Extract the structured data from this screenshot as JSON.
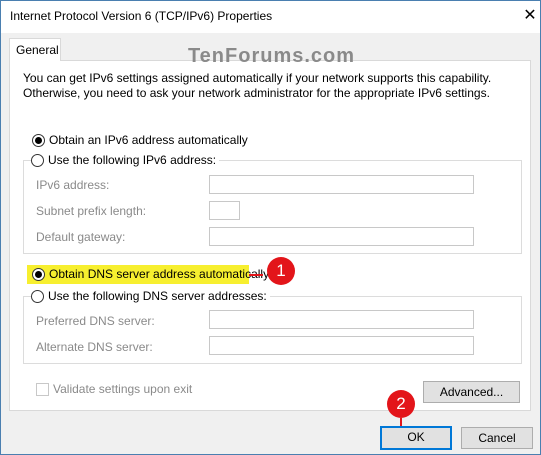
{
  "window": {
    "title": "Internet Protocol Version 6 (TCP/IPv6) Properties",
    "close_glyph": "✕"
  },
  "tabs": [
    {
      "label": "General"
    }
  ],
  "watermark": "TenForums.com",
  "description": "You can get IPv6 settings assigned automatically if your network supports this capability. Otherwise, you need to ask your network administrator for the appropriate IPv6 settings.",
  "ip": {
    "auto_label": "Obtain an IPv6 address automatically",
    "auto_selected": true,
    "manual_label": "Use the following IPv6 address:",
    "manual_selected": false,
    "fields": [
      {
        "label": "IPv6 address:",
        "value": ""
      },
      {
        "label": "Subnet prefix length:",
        "value": ""
      },
      {
        "label": "Default gateway:",
        "value": ""
      }
    ]
  },
  "dns": {
    "auto_label": "Obtain DNS server address automatically",
    "auto_selected": true,
    "manual_label": "Use the following DNS server addresses:",
    "manual_selected": false,
    "fields": [
      {
        "label": "Preferred DNS server:",
        "value": ""
      },
      {
        "label": "Alternate DNS server:",
        "value": ""
      }
    ]
  },
  "validate": {
    "label": "Validate settings upon exit",
    "checked": false
  },
  "buttons": {
    "advanced": "Advanced...",
    "ok": "OK",
    "cancel": "Cancel"
  },
  "annotations": [
    {
      "number": "1"
    },
    {
      "number": "2"
    }
  ],
  "colors": {
    "highlight": "#f7ef2f",
    "badge": "#e3151a",
    "focus": "#0078d7"
  }
}
